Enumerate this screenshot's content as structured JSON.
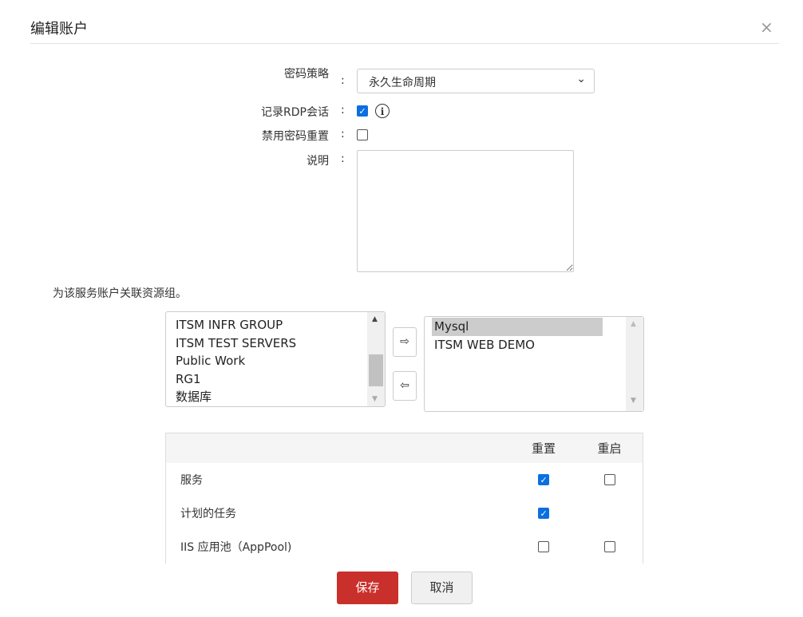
{
  "dialog": {
    "title": "编辑账户",
    "close": "×"
  },
  "form": {
    "policy_label": "密码策略",
    "policy_value": "永久生命周期",
    "rdp_label": "记录RDP会话",
    "rdp_checked": true,
    "disable_reset_label": "禁用密码重置",
    "disable_reset_checked": false,
    "desc_label": "说明",
    "colon": ":",
    "info": "i"
  },
  "resource_groups": {
    "heading": "为该服务账户关联资源组。",
    "available": [
      "ITSM INFR GROUP",
      "ITSM TEST SERVERS",
      "Public Work",
      "RG1",
      "数据库"
    ],
    "selected": [
      "Mysql",
      "ITSM WEB DEMO"
    ],
    "add": "⇨",
    "remove": "⇦"
  },
  "table": {
    "headers": [
      "",
      "重置",
      "重启"
    ],
    "rows": [
      {
        "name": "服务",
        "reset": true,
        "restart": false
      },
      {
        "name": "计划的任务",
        "reset": true,
        "restart": null
      },
      {
        "name": "IIS 应用池（AppPool)",
        "reset": false,
        "restart": false
      }
    ]
  },
  "buttons": {
    "save": "保存",
    "cancel": "取消"
  }
}
